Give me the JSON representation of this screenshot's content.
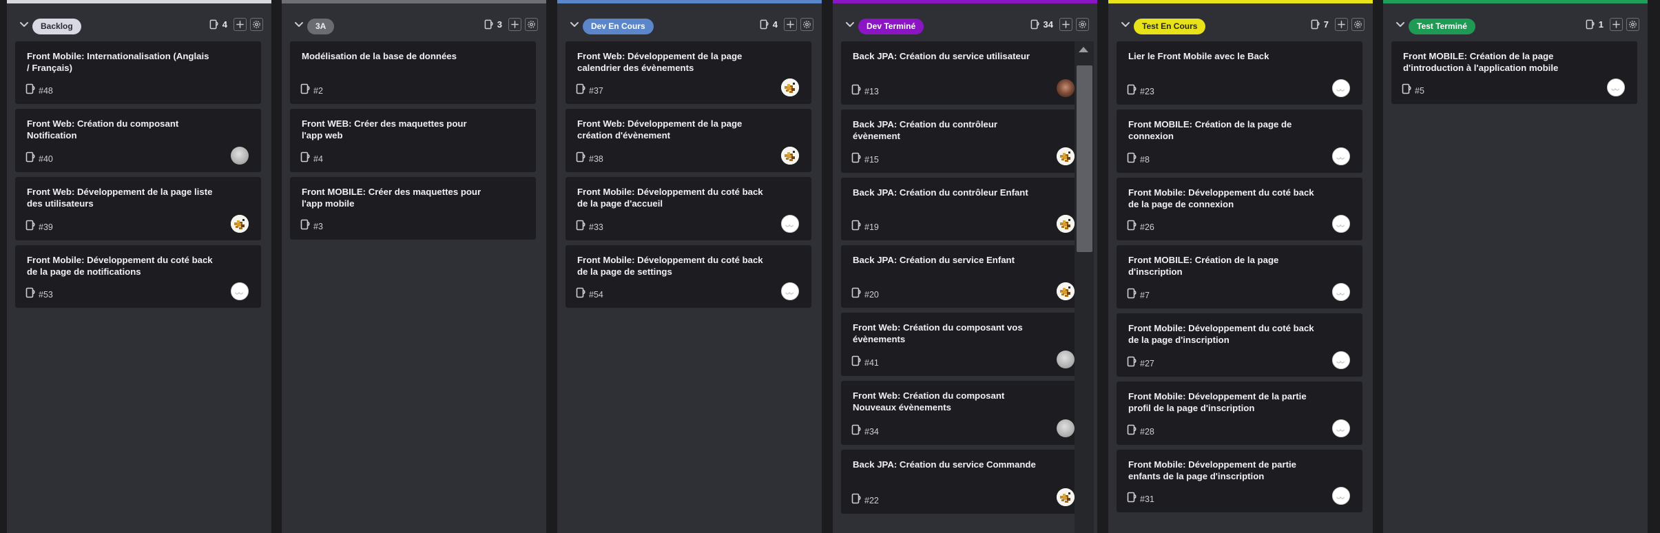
{
  "columns": [
    {
      "id": "backlog",
      "label": "Backlog",
      "count": "4",
      "top_color": "#d7d7e0",
      "badge_bg": "#d9d9e3",
      "badge_fg": "#2a2a33",
      "cards": [
        {
          "title": "Front Mobile: Internationalisation (Anglais / Français)",
          "number": "#48",
          "avatar": "none"
        },
        {
          "title": "Front Web: Création du composant Notification",
          "number": "#40",
          "avatar": "gray"
        },
        {
          "title": "Front Web: Développement de la page liste des utilisateurs",
          "number": "#39",
          "avatar": "pixel"
        },
        {
          "title": "Front Mobile: Développement du coté back de la page de notifications",
          "number": "#53",
          "avatar": "default"
        }
      ]
    },
    {
      "id": "3a",
      "label": "3A",
      "count": "3",
      "top_color": "#6e6f75",
      "badge_bg": "#6b6c72",
      "badge_fg": "#f0f0f0",
      "cards": [
        {
          "title": "Modélisation de la base de données",
          "number": "#2",
          "avatar": "none"
        },
        {
          "title": "Front WEB: Créer des maquettes pour l'app web",
          "number": "#4",
          "avatar": "none"
        },
        {
          "title": "Front MOBILE: Créer des maquettes pour l'app mobile",
          "number": "#3",
          "avatar": "none"
        }
      ]
    },
    {
      "id": "dev-en-cours",
      "label": "Dev En Cours",
      "count": "4",
      "top_color": "#5b86c9",
      "badge_bg": "#5b86c9",
      "badge_fg": "#ffffff",
      "cards": [
        {
          "title": "Front Web: Développement de la page calendrier des évènements",
          "number": "#37",
          "avatar": "pixel"
        },
        {
          "title": "Front Web: Développement de la page création d'évènement",
          "number": "#38",
          "avatar": "pixel"
        },
        {
          "title": "Front Mobile: Développement du coté back de la page d'accueil",
          "number": "#33",
          "avatar": "default"
        },
        {
          "title": "Front Mobile: Développement du coté back de la page de settings",
          "number": "#54",
          "avatar": "default"
        }
      ]
    },
    {
      "id": "dev-termine",
      "label": "Dev Terminé",
      "count": "34",
      "top_color": "#8b15c2",
      "badge_bg": "#8b15c2",
      "badge_fg": "#ffffff",
      "cards": [
        {
          "title": "Back JPA: Création du service utilisateur",
          "number": "#13",
          "avatar": "brown"
        },
        {
          "title": "Back JPA: Création du contrôleur évènement",
          "number": "#15",
          "avatar": "pixel"
        },
        {
          "title": "Back JPA: Création du contrôleur Enfant",
          "number": "#19",
          "avatar": "pixel"
        },
        {
          "title": "Back JPA: Création du service Enfant",
          "number": "#20",
          "avatar": "pixel"
        },
        {
          "title": "Front Web: Création du composant vos évènements",
          "number": "#41",
          "avatar": "gray"
        },
        {
          "title": "Front Web: Création du composant Nouveaux évènements",
          "number": "#34",
          "avatar": "gray"
        },
        {
          "title": "Back JPA: Création du service Commande",
          "number": "#22",
          "avatar": "pixel"
        }
      ]
    },
    {
      "id": "test-en-cours",
      "label": "Test En Cours",
      "count": "7",
      "top_color": "#e8e21a",
      "badge_bg": "#e8e21a",
      "badge_fg": "#2a2a10",
      "cards": [
        {
          "title": "Lier le Front Mobile avec le Back",
          "number": "#23",
          "avatar": "default"
        },
        {
          "title": "Front MOBILE: Création de la page de connexion",
          "number": "#8",
          "avatar": "default"
        },
        {
          "title": "Front Mobile: Développement du coté back de la page de connexion",
          "number": "#26",
          "avatar": "default"
        },
        {
          "title": "Front MOBILE: Création de la page d'inscription",
          "number": "#7",
          "avatar": "default"
        },
        {
          "title": "Front Mobile: Développement du coté back de la page d'inscription",
          "number": "#27",
          "avatar": "default"
        },
        {
          "title": "Front Mobile: Développement de la partie profil de la page d'inscription",
          "number": "#28",
          "avatar": "default"
        },
        {
          "title": "Front Mobile: Développement de partie enfants de la page d'inscription",
          "number": "#31",
          "avatar": "default"
        }
      ]
    },
    {
      "id": "test-termine",
      "label": "Test Terminé",
      "count": "1",
      "top_color": "#1fa05a",
      "badge_bg": "#1f9a55",
      "badge_fg": "#ffffff",
      "cards": [
        {
          "title": "Front MOBILE: Création de la page d'introduction à l'application mobile",
          "number": "#5",
          "avatar": "default"
        }
      ]
    }
  ]
}
